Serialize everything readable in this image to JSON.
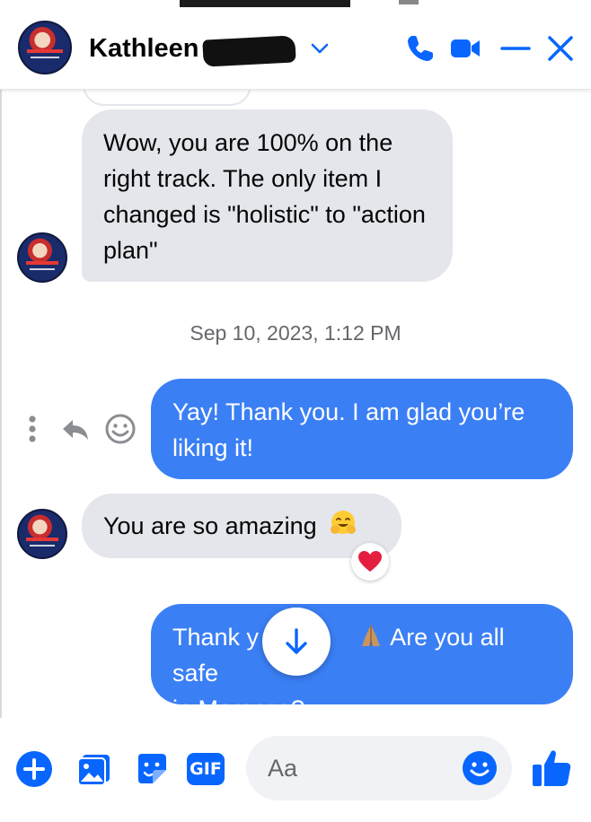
{
  "header": {
    "contact_name": "Kathleen",
    "icons": [
      "chevron-down-icon",
      "phone-icon",
      "video-camera-icon",
      "minimize-icon",
      "close-icon"
    ]
  },
  "messages": [
    {
      "direction": "incoming",
      "text": "Wow, you are 100% on the right track. The only item I changed is \"holistic\" to \"action plan\""
    },
    {
      "direction": "outgoing",
      "text": "Yay! Thank you. I am glad you’re liking it!"
    },
    {
      "direction": "incoming",
      "text": "You are so amazing",
      "emoji": "hugging-face",
      "reaction": "heart"
    },
    {
      "direction": "outgoing",
      "text_part1": "Thank y",
      "text_part2": "Are you all safe",
      "text_line2": "in Morocco?",
      "emoji": "folded-hands"
    }
  ],
  "timestamp": "Sep 10, 2023, 1:12 PM",
  "composer": {
    "placeholder": "Aa",
    "gif_label": "GIF"
  },
  "colors": {
    "accent": "#0866ff",
    "outgoing_bubble": "#3b7ff5",
    "incoming_bubble": "#e4e6eb",
    "heart": "#e41e3f"
  }
}
